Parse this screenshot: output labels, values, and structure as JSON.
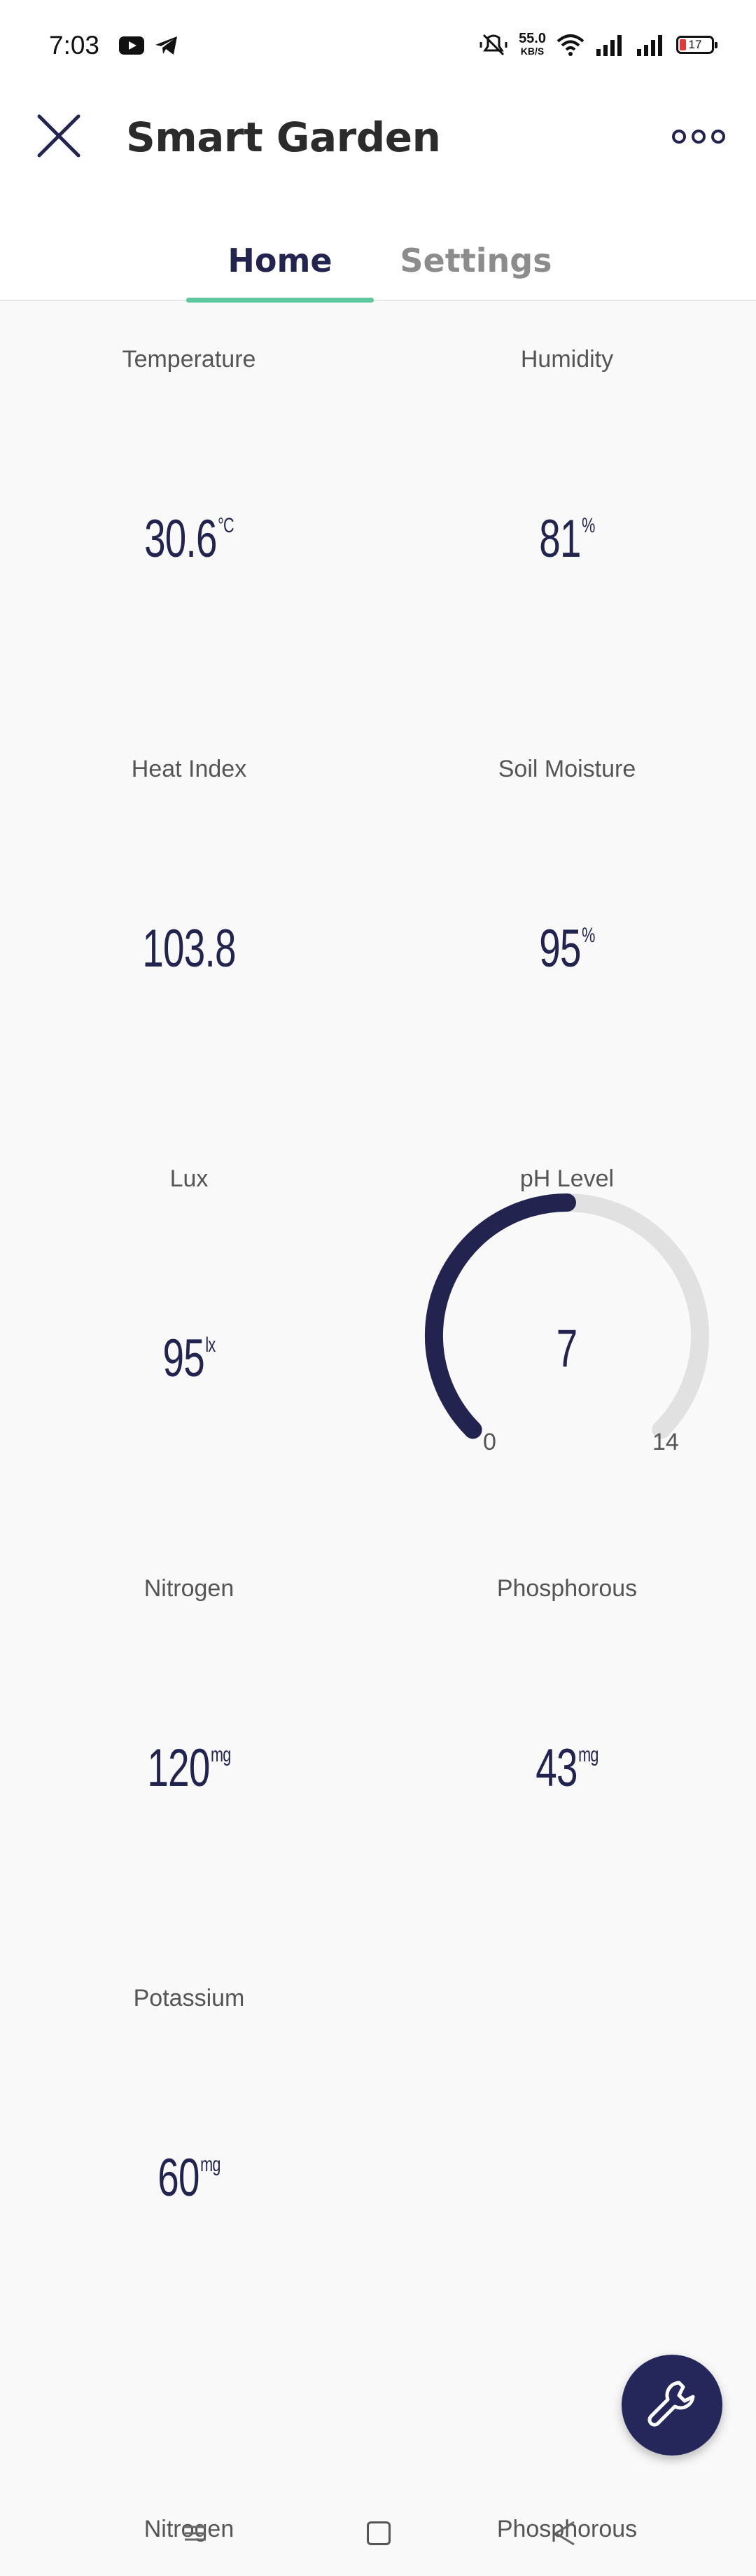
{
  "status_bar": {
    "time": "7:03",
    "net_speed": "55.0",
    "net_unit": "KB/S",
    "battery": "17",
    "icons": [
      "youtube-icon",
      "telegram-icon",
      "mute-icon",
      "wifi-icon",
      "signal-icon",
      "battery-icon"
    ]
  },
  "header": {
    "title": "Smart Garden",
    "close_icon": "close-icon",
    "more_icon": "more-icon"
  },
  "tabs": [
    {
      "label": "Home",
      "active": true
    },
    {
      "label": "Settings",
      "active": false
    }
  ],
  "widgets": {
    "temperature": {
      "label": "Temperature",
      "value": "30.6",
      "unit": "°C"
    },
    "humidity": {
      "label": "Humidity",
      "value": "81",
      "unit": "%"
    },
    "heat_index": {
      "label": "Heat Index",
      "value": "103.8",
      "unit": ""
    },
    "soil_moisture": {
      "label": "Soil Moisture",
      "value": "95",
      "unit": "%"
    },
    "lux": {
      "label": "Lux",
      "value": "95",
      "unit": "lx"
    },
    "ph_level": {
      "label": "pH Level",
      "value": "7",
      "min": "0",
      "max": "14",
      "fraction": 0.5
    },
    "nitrogen": {
      "label": "Nitrogen",
      "value": "120",
      "unit": "mg"
    },
    "phosphorous": {
      "label": "Phosphorous",
      "value": "43",
      "unit": "mg"
    },
    "potassium": {
      "label": "Potassium",
      "value": "60",
      "unit": "mg"
    }
  },
  "bottom_row": {
    "left_label": "Nitrogen",
    "right_label": "Phosphorous"
  },
  "fab": {
    "icon": "wrench-icon"
  },
  "colors": {
    "accent": "#22244f",
    "tab_indicator": "#5ec8a0",
    "gauge_track": "#e1e1e1",
    "background": "#f9f9f9"
  }
}
